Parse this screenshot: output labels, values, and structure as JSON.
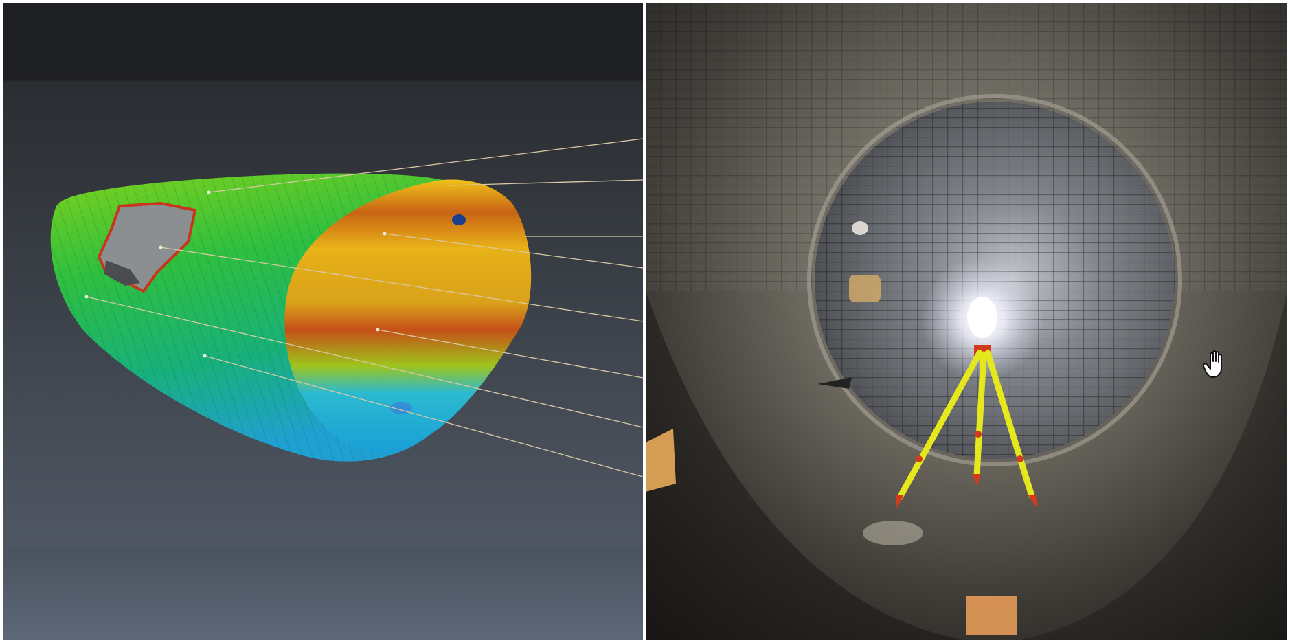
{
  "panels": {
    "left": {
      "label": "",
      "background_top": "#1e1f22",
      "background_bottom": "#5b6573",
      "scan_color_scale": [
        "#1aa6d8",
        "#22c25a",
        "#8cd61e",
        "#f2c318",
        "#e07a12",
        "#c63a1a"
      ]
    },
    "right": {
      "label": "",
      "tripod_leg_color": "#e6e81e",
      "tripod_accent_color": "#d23a1e",
      "lamp_color": "#ffffff"
    }
  },
  "cursor": {
    "icon": "hand-pointer-icon"
  }
}
